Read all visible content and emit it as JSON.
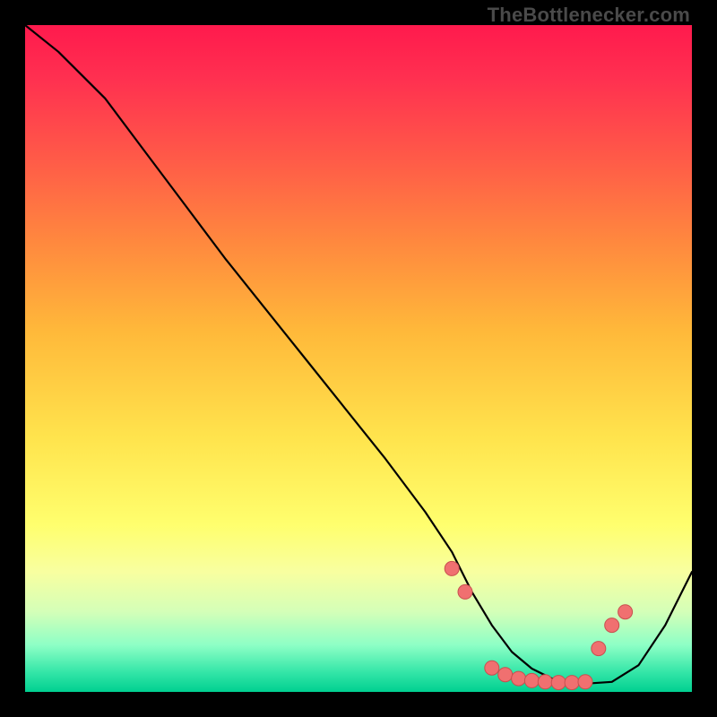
{
  "attribution": "TheBottlenecker.com",
  "colors": {
    "background": "#000000",
    "curve": "#000000",
    "marker_fill": "#f07070",
    "marker_stroke": "#c84f4f",
    "gradient_top": "#ff1a4d",
    "gradient_bottom": "#00d090"
  },
  "chart_data": {
    "type": "line",
    "title": "",
    "xlabel": "",
    "ylabel": "",
    "xlim": [
      0,
      100
    ],
    "ylim": [
      0,
      100
    ],
    "x": [
      0,
      5,
      12,
      18,
      24,
      30,
      36,
      42,
      48,
      54,
      60,
      64,
      67,
      70,
      73,
      76,
      79,
      82,
      85,
      88,
      92,
      96,
      100
    ],
    "values": [
      100,
      96,
      89,
      81,
      73,
      65,
      57.5,
      50,
      42.5,
      35,
      27,
      21,
      15,
      10,
      6,
      3.5,
      2,
      1.5,
      1.3,
      1.5,
      4,
      10,
      18
    ],
    "markers": {
      "x": [
        64,
        66,
        70,
        72,
        74,
        76,
        78,
        80,
        82,
        84,
        86,
        88,
        90
      ],
      "y": [
        18.5,
        15,
        3.6,
        2.6,
        2.0,
        1.7,
        1.5,
        1.4,
        1.4,
        1.5,
        6.5,
        10,
        12
      ]
    }
  }
}
